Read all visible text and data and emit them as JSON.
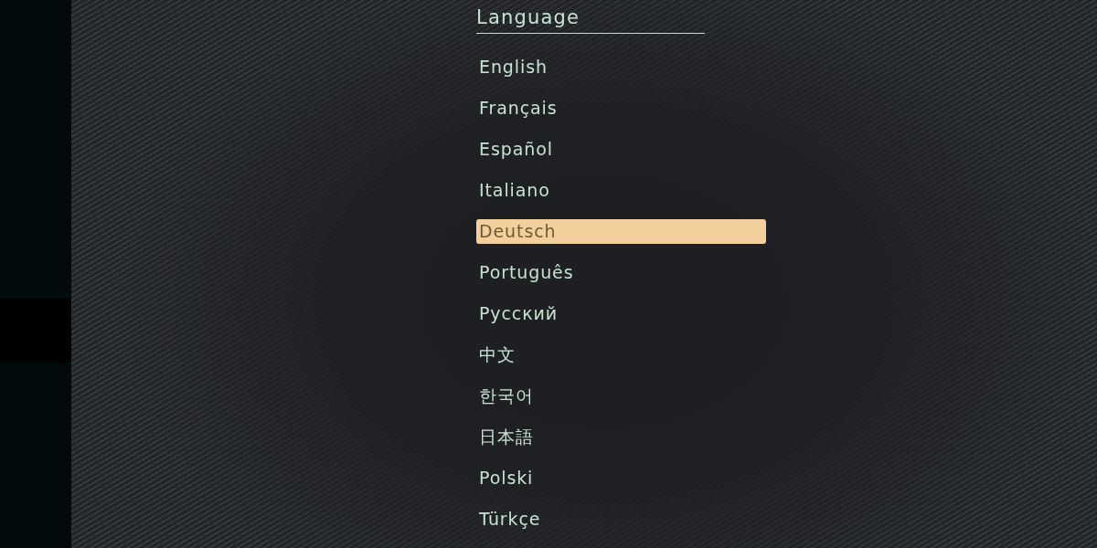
{
  "title": "Language",
  "languages": [
    {
      "label": "English",
      "selected": false
    },
    {
      "label": "Français",
      "selected": false
    },
    {
      "label": "Español",
      "selected": false
    },
    {
      "label": "Italiano",
      "selected": false
    },
    {
      "label": "Deutsch",
      "selected": true
    },
    {
      "label": "Português",
      "selected": false
    },
    {
      "label": "Русский",
      "selected": false
    },
    {
      "label": "中文",
      "selected": false
    },
    {
      "label": "한국어",
      "selected": false
    },
    {
      "label": "日本語",
      "selected": false
    },
    {
      "label": "Polski",
      "selected": false
    },
    {
      "label": "Türkçe",
      "selected": false
    }
  ]
}
